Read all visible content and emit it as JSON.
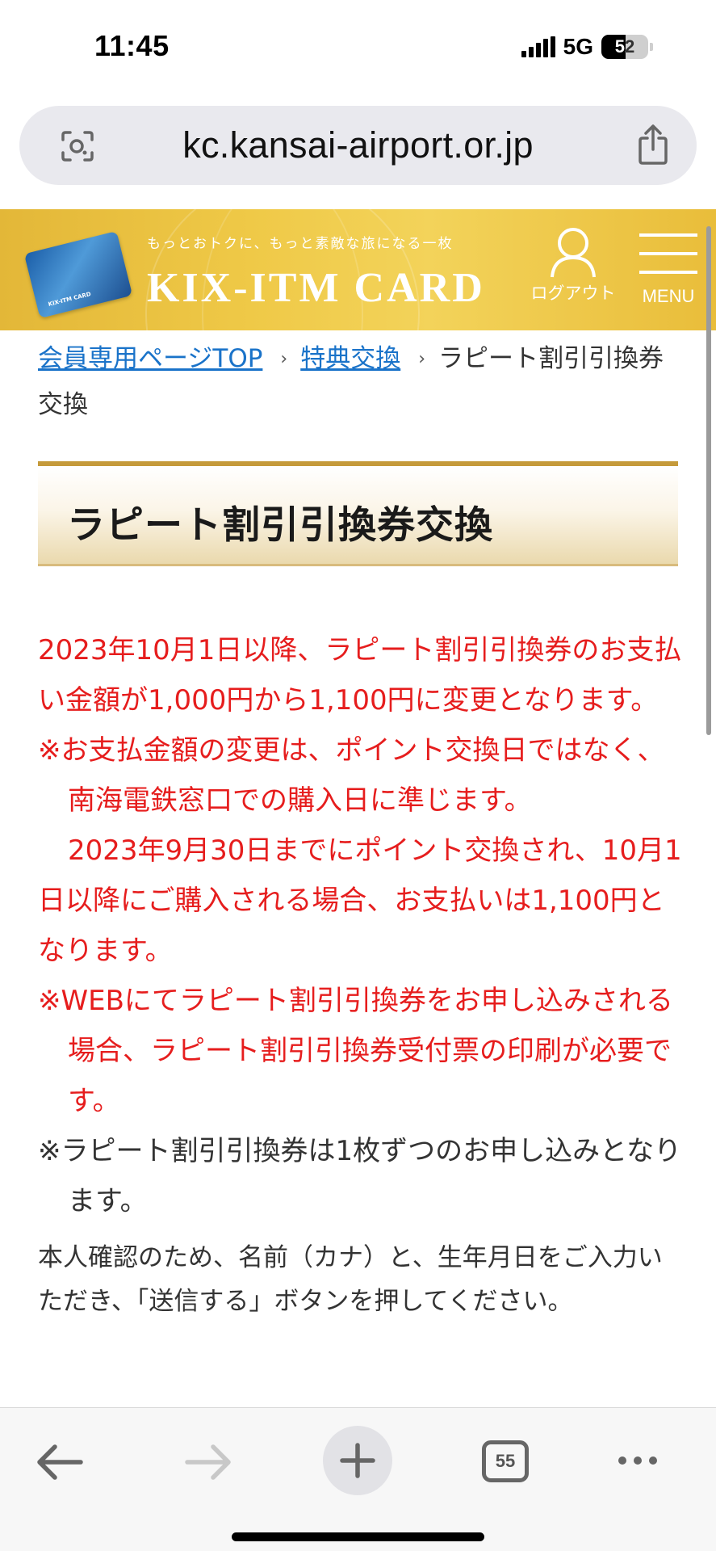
{
  "status_bar": {
    "time": "11:45",
    "network": "5G",
    "battery": "52"
  },
  "browser": {
    "url": "kc.kansai-airport.or.jp",
    "lens_icon": "camera-search-icon",
    "share_icon": "share-icon"
  },
  "header": {
    "tagline": "もっとおトクに、もっと素敵な旅になる一枚",
    "brand": "KIX-ITM CARD",
    "card_label": "KIX-ITM CARD",
    "logout_label": "ログアウト",
    "menu_label": "MENU"
  },
  "breadcrumb": {
    "items": [
      {
        "label": "会員専用ページTOP"
      },
      {
        "label": "特典交換"
      },
      {
        "label": "ラピート割引引換券交換"
      }
    ],
    "separator": "›"
  },
  "page_title": "ラピート割引引換券交換",
  "notices": {
    "p1": "2023年10月1日以降、ラピート割引引換券のお支払い金額が1,000円から1,100円に変更となります。",
    "n1": "※お支払金額の変更は、ポイント交換日ではなく、南海電鉄窓口での購入日に準じます。",
    "n1_cont": "2023年9月30日までにポイント交換され、10月1日以降にご購入される場合、お支払いは1,100円となります。",
    "n2": "※WEBにてラピート割引引換券をお申し込みされる場合、ラピート割引引換券受付票の印刷が必要です。",
    "n3": "※ラピート割引引換券は1枚ずつのお申し込みとなります。",
    "instruction": "本人確認のため、名前（カナ）と、生年月日をご入力いただき、「送信する」ボタンを押してください。"
  },
  "toolbar": {
    "tab_count": "55"
  },
  "colors": {
    "header_gold": "#efc947",
    "notice_red": "#e61d1d",
    "link_blue": "#1a73c9",
    "title_border": "#c59a3b"
  }
}
